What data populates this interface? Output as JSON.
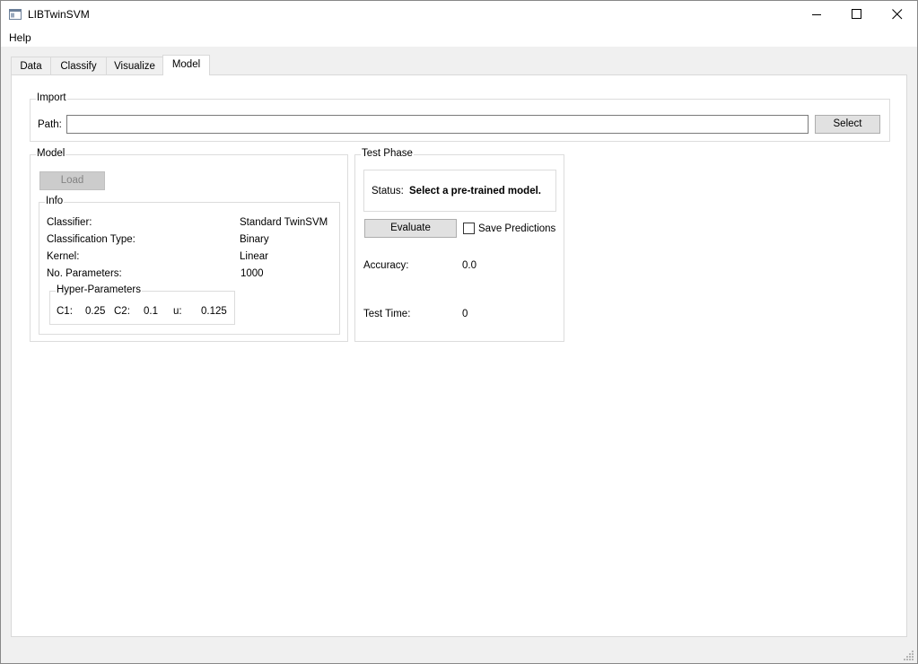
{
  "window": {
    "title": "LIBTwinSVM",
    "controls": [
      "minimize-icon",
      "maximize-icon",
      "close-icon"
    ]
  },
  "menu": {
    "help": "Help"
  },
  "tabs": [
    {
      "label": "Data",
      "active": false
    },
    {
      "label": "Classify",
      "active": false
    },
    {
      "label": "Visualize",
      "active": false
    },
    {
      "label": "Model",
      "active": true
    }
  ],
  "import": {
    "title": "Import",
    "path_label": "Path:",
    "path_value": "",
    "select_label": "Select"
  },
  "model": {
    "title": "Model",
    "load_label": "Load",
    "info": {
      "title": "Info",
      "rows": [
        {
          "key": "Classifier:",
          "value": "Standard TwinSVM"
        },
        {
          "key": "Classification Type:",
          "value": "Binary"
        },
        {
          "key": "Kernel:",
          "value": "Linear"
        },
        {
          "key": "No. Parameters:",
          "value": "1000"
        }
      ],
      "hyper": {
        "title": "Hyper-Parameters",
        "c1_label": "C1:",
        "c1_value": "0.25",
        "c2_label": "C2:",
        "c2_value": "0.1",
        "u_label": "u:",
        "u_value": "0.125"
      }
    }
  },
  "test": {
    "title": "Test Phase",
    "status_label": "Status:",
    "status_value": "Select a pre-trained model.",
    "evaluate_label": "Evaluate",
    "save_predictions_label": "Save Predictions",
    "save_predictions_checked": false,
    "accuracy_label": "Accuracy:",
    "accuracy_value": "0.0",
    "time_label": "Test Time:",
    "time_value": "0"
  }
}
